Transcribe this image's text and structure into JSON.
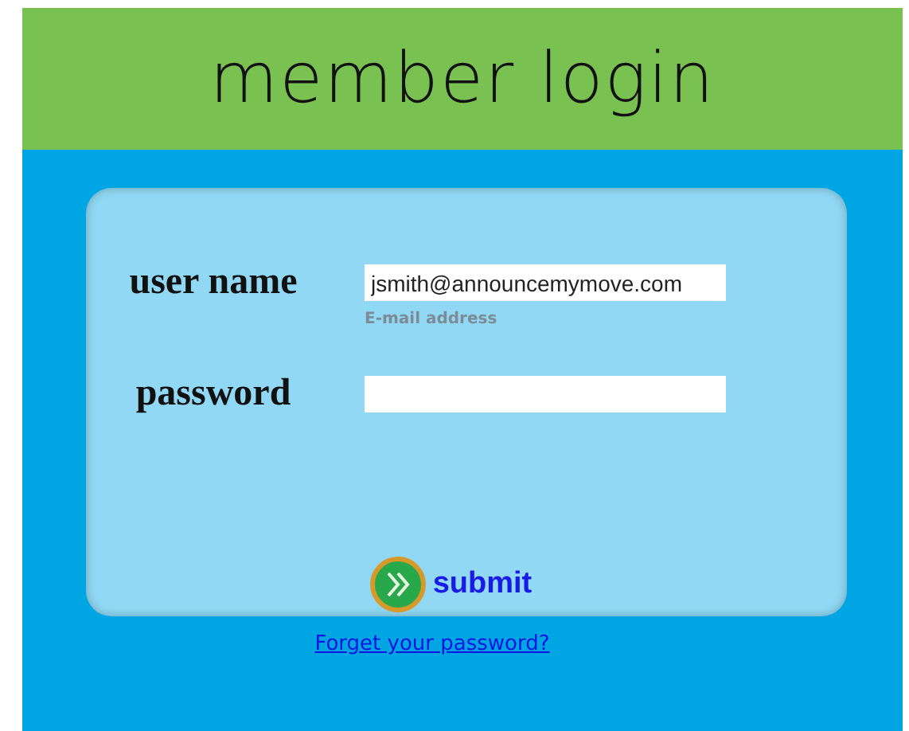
{
  "header": {
    "title": "member login"
  },
  "fields": [
    {
      "label": "user name",
      "value": "jsmith@announcemymove.com",
      "hint": "E-mail address"
    },
    {
      "label": "password"
    }
  ],
  "submit": {
    "label": "submit"
  },
  "forgot_link": "Forget your password?"
}
